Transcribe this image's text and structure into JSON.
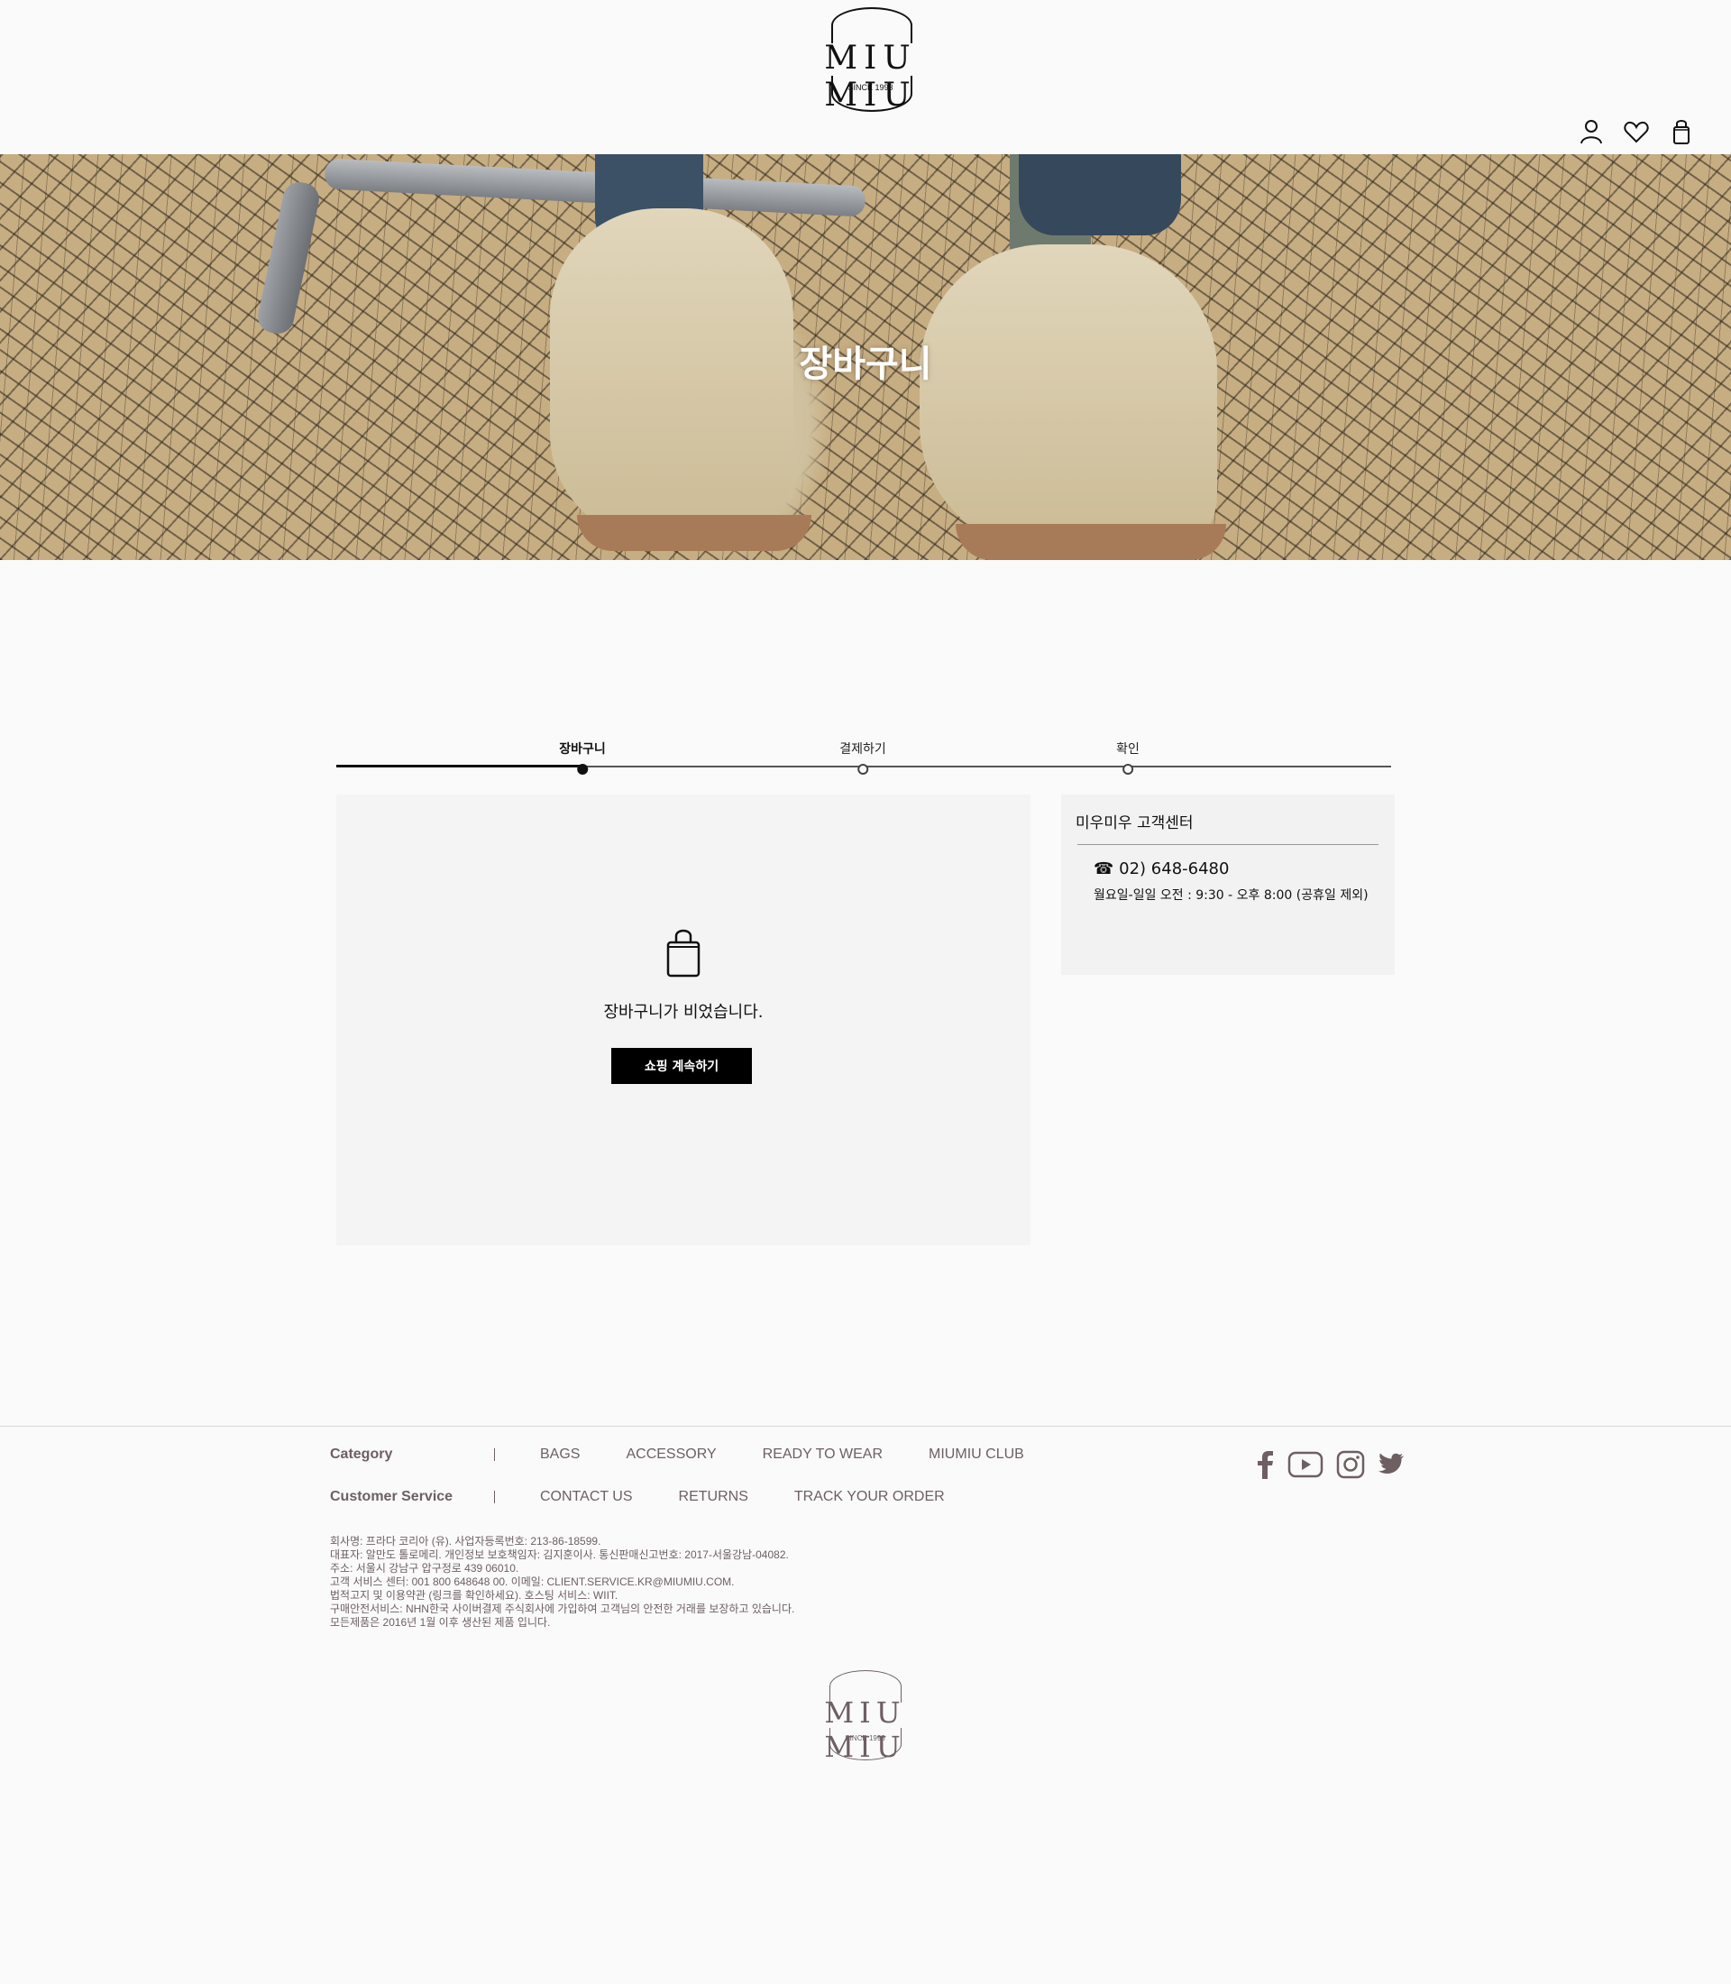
{
  "header": {
    "logo_text": "MIU MIU",
    "logo_since": "SINCE 1993",
    "icons": [
      "user-icon",
      "heart-icon",
      "shopping-bag-icon"
    ]
  },
  "hero": {
    "title": "장바구니"
  },
  "steps": [
    {
      "label": "장바구니",
      "active": true
    },
    {
      "label": "결제하기",
      "active": false
    },
    {
      "label": "확인",
      "active": false
    }
  ],
  "cart": {
    "empty_message": "장바구니가 비었습니다.",
    "continue_button": "쇼핑 계속하기"
  },
  "customer_center": {
    "title": "미우미우 고객센터",
    "phone": "☎ 02) 648-6480",
    "hours": "월요일-일일 오전 : 9:30 - 오후 8:00 (공휴일 제외)"
  },
  "footer": {
    "category_label": "Category",
    "category_links": [
      "BAGS",
      "ACCESSORY",
      "READY TO WEAR",
      "MIUMIU CLUB"
    ],
    "service_label": "Customer Service",
    "service_links": [
      "CONTACT US",
      "RETURNS",
      "TRACK YOUR ORDER"
    ],
    "social": [
      "facebook-icon",
      "youtube-icon",
      "instagram-icon",
      "twitter-icon"
    ],
    "legal": [
      "회사명: 프라다 코리아 (유). 사업자등록번호: 213-86-18599.",
      "대표자: 알만도 톨로메리. 개인정보 보호책임자: 김지훈이사. 통신판매신고번호: 2017-서울강남-04082.",
      "주소: 서울시 강남구 압구정로 439 06010.",
      "고객 서비스 센터: 001 800 648648 00. 이메일: CLIENT.SERVICE.KR@MIUMIU.COM.",
      "법적고지 및 이용약관 (링크를 확인하세요). 호스팅 서비스: WIIT.",
      "구매안전서비스: NHN한국 사이버결제 주식회사에 가입하여 고객님의 안전한 거래를 보장하고 있습니다.",
      "모든제품은 2016년 1월 이후 생산된 제품 입니다."
    ],
    "logo_text": "MIU MIU",
    "logo_since": "SINCE 1993"
  }
}
